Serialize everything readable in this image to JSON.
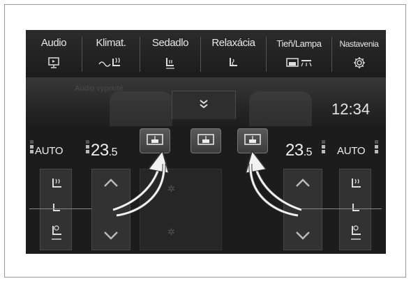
{
  "menu": {
    "items": [
      {
        "label": "Audio",
        "icon": "monitor-icon"
      },
      {
        "label": "Klimat.",
        "icon": "climate-icon"
      },
      {
        "label": "Sedadlo",
        "icon": "seat-icon"
      },
      {
        "label": "Relaxácia",
        "icon": "massage-seat-icon"
      },
      {
        "label": "Tieň/Lampa",
        "icon": "shade-lamp-icon"
      },
      {
        "label": "Nastavenia",
        "icon": "gear-icon"
      }
    ]
  },
  "status": {
    "faded_text": "Audio vypnuté",
    "clock": "12:34"
  },
  "climate": {
    "left": {
      "auto_label": "AUTO",
      "temp_main": "23",
      "temp_decimal": ".5"
    },
    "right": {
      "auto_label": "AUTO",
      "temp_main": "23",
      "temp_decimal": ".5"
    }
  },
  "colors": {
    "screen_bg": "#161616",
    "text": "#e8e8e8",
    "button": "#4a4a4a"
  }
}
